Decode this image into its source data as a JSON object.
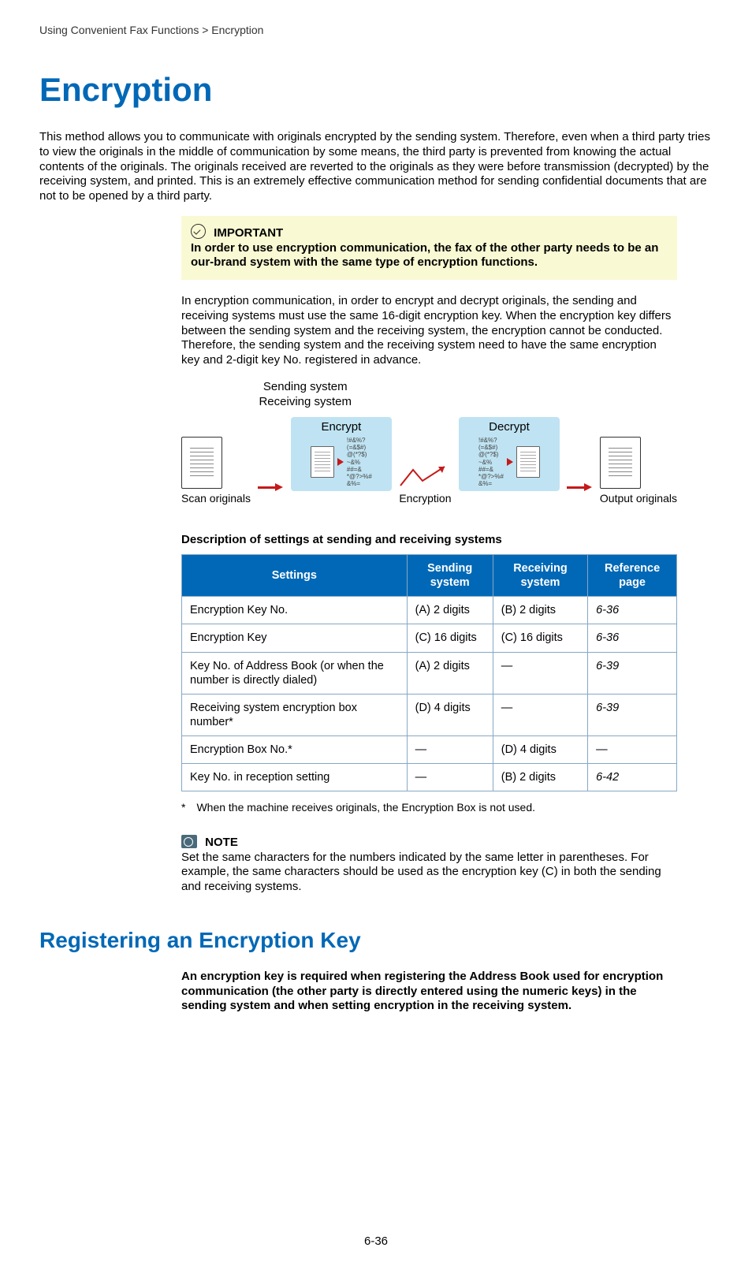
{
  "breadcrumb": "Using Convenient Fax Functions > Encryption",
  "title": "Encryption",
  "intro": "This method allows you to communicate with originals encrypted by the sending system. Therefore, even when a third party tries to view the originals in the middle of communication by some means, the third party is prevented from knowing the actual contents of the originals. The originals received are reverted to the originals as they were before transmission (decrypted) by the receiving system, and printed. This is an extremely effective communication method for sending confidential documents that are not to be opened by a third party.",
  "important": {
    "label": "IMPORTANT",
    "text": "In order to use encryption communication, the fax of the other party needs to be an our-brand system with the same type of encryption functions."
  },
  "para2": "In encryption communication, in order to encrypt and decrypt originals, the sending and receiving systems must use the same 16-digit encryption key. When the encryption key differs between the sending system and the receiving system, the encryption cannot be conducted. Therefore, the sending system and the receiving system need to have the same encryption key and 2-digit key No. registered in advance.",
  "diagram": {
    "sending_label": "Sending system",
    "receiving_label": "Receiving system",
    "encrypt": "Encrypt",
    "decrypt": "Decrypt",
    "scan": "Scan originals",
    "encryption": "Encryption",
    "output": "Output originals"
  },
  "table": {
    "caption": "Description of settings at sending and receiving systems",
    "headers": {
      "settings": "Settings",
      "send": "Sending system",
      "recv": "Receiving system",
      "ref": "Reference page"
    },
    "rows": [
      {
        "s": "Encryption Key No.",
        "send": "(A) 2 digits",
        "recv": "(B) 2 digits",
        "ref": "6-36"
      },
      {
        "s": "Encryption Key",
        "send": "(C) 16 digits",
        "recv": "(C) 16 digits",
        "ref": "6-36"
      },
      {
        "s": "Key No. of Address Book (or when the number is directly dialed)",
        "send": "(A) 2 digits",
        "recv": "—",
        "ref": "6-39"
      },
      {
        "s": "Receiving system encryption box number*",
        "send": "(D) 4 digits",
        "recv": "—",
        "ref": "6-39"
      },
      {
        "s": "Encryption Box No.*",
        "send": "—",
        "recv": "(D) 4 digits",
        "ref": "—"
      },
      {
        "s": "Key No. in reception setting",
        "send": "—",
        "recv": "(B) 2 digits",
        "ref": "6-42"
      }
    ]
  },
  "footnote": "* When the machine receives originals, the Encryption Box is not used.",
  "note": {
    "label": "NOTE",
    "text": "Set the same characters for the numbers indicated by the same letter in parentheses. For example, the same characters should be used as the encryption key (C) in both the sending and receiving systems."
  },
  "subheading": "Registering an Encryption Key",
  "subtext": "An encryption key is required when registering the Address Book used for encryption communication (the other party is directly entered using the numeric keys) in the sending system and when setting encryption in the receiving system.",
  "pagenum": "6-36"
}
